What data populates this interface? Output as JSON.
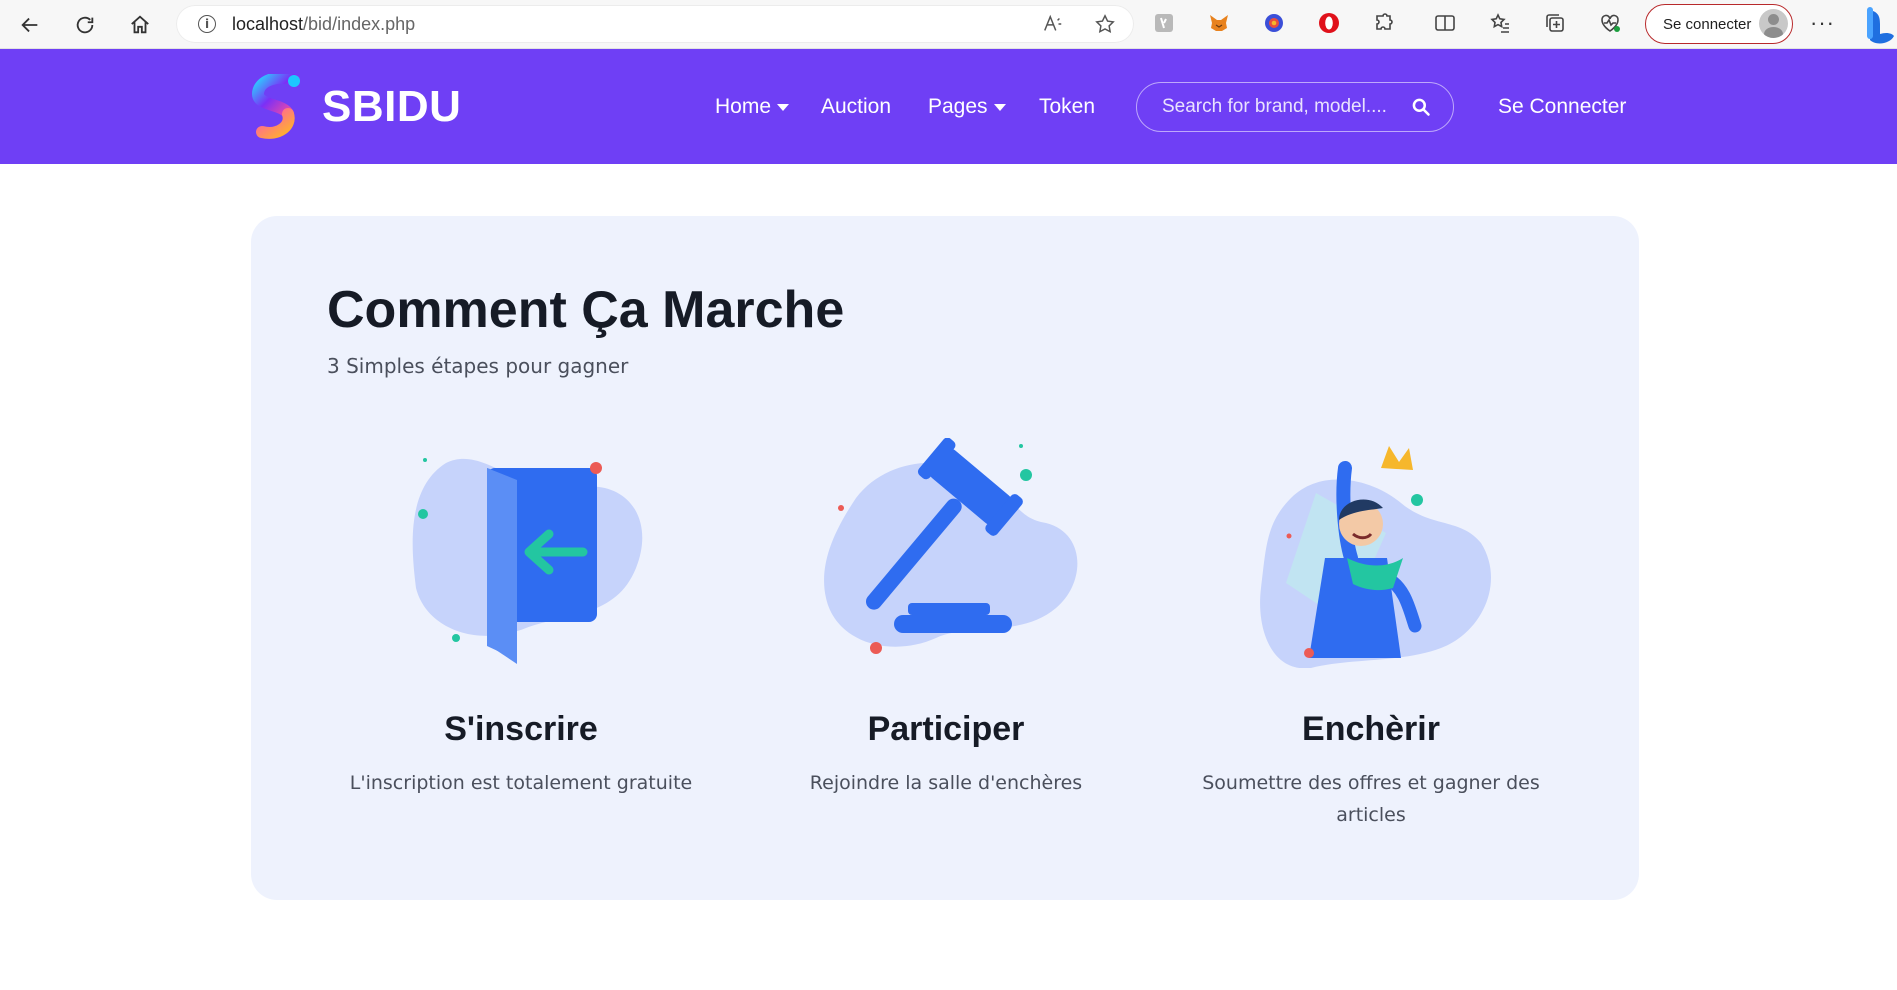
{
  "browser": {
    "url_host": "localhost",
    "url_path": "/bid/index.php",
    "signin_label": "Se connecter",
    "more_label": "···"
  },
  "header": {
    "brand": "SBIDU",
    "nav": [
      {
        "label": "Home",
        "dropdown": true
      },
      {
        "label": "Auction",
        "dropdown": false
      },
      {
        "label": "Pages",
        "dropdown": true
      },
      {
        "label": "Token",
        "dropdown": false
      }
    ],
    "search_placeholder": "Search for brand, model....",
    "connect_label": "Se Connecter",
    "colors": {
      "header_bg": "#6f3ff5",
      "card_bg": "#eef2fd",
      "accent_blue": "#2f6cf0",
      "accent_green": "#23c6a1"
    }
  },
  "main": {
    "title": "Comment Ça Marche",
    "subtitle": "3 Simples étapes pour gagner",
    "steps": [
      {
        "icon": "door-enter-icon",
        "title": "S'inscrire",
        "text": "L'inscription est totalement gratuite"
      },
      {
        "icon": "gavel-icon",
        "title": "Participer",
        "text": "Rejoindre la salle d'enchères"
      },
      {
        "icon": "winner-crown-icon",
        "title": "Enchèrir",
        "text": "Soumettre des offres et gagner des articles"
      }
    ]
  }
}
